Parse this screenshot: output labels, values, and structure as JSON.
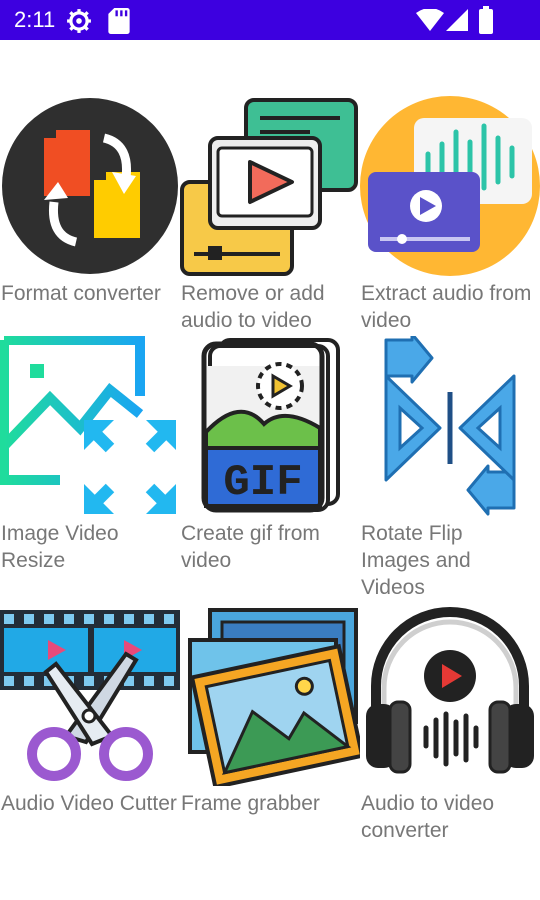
{
  "status_bar": {
    "time": "2:11",
    "icons": [
      "settings-gear-icon",
      "sd-card-icon",
      "wifi-icon",
      "cellular-signal-icon",
      "battery-icon"
    ],
    "background": "#3d00e0"
  },
  "tools": [
    {
      "label": "Format converter",
      "icon": "format-converter-icon"
    },
    {
      "label": "Remove or add audio to video",
      "icon": "video-player-icon"
    },
    {
      "label": "Extract audio from video",
      "icon": "audio-extract-icon"
    },
    {
      "label": "Image Video Resize",
      "icon": "resize-icon"
    },
    {
      "label": "Create gif from video",
      "icon": "gif-icon"
    },
    {
      "label": "Rotate Flip Images and Videos",
      "icon": "rotate-flip-icon"
    },
    {
      "label": "Audio Video Cutter",
      "icon": "scissors-cutter-icon"
    },
    {
      "label": "Frame grabber",
      "icon": "frame-grabber-icon"
    },
    {
      "label": "Audio to video converter",
      "icon": "headphones-icon"
    }
  ]
}
